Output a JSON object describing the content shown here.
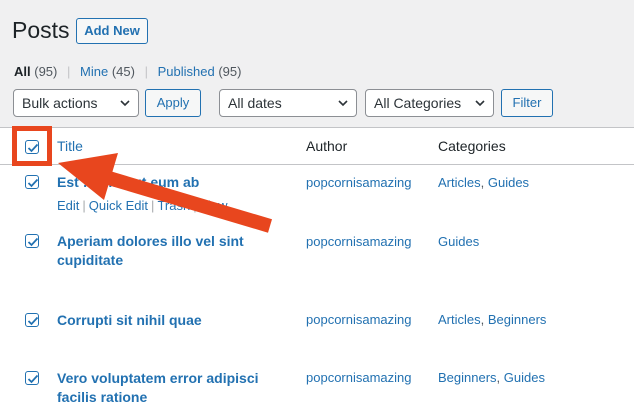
{
  "header": {
    "title": "Posts",
    "add_new": "Add New"
  },
  "views": {
    "all": "All",
    "all_count": "(95)",
    "mine": "Mine",
    "mine_count": "(45)",
    "published": "Published",
    "published_count": "(95)",
    "separator": "|"
  },
  "toolbar": {
    "bulk_actions": "Bulk actions",
    "apply": "Apply",
    "dates": "All dates",
    "categories": "All Categories",
    "filter": "Filter"
  },
  "table": {
    "columns": {
      "title": "Title",
      "author": "Author",
      "categories": "Categories"
    },
    "rows": [
      {
        "title": "Est … emo ut eum ab",
        "author": "popcornisamazing",
        "categories": [
          "Articles",
          "Guides"
        ],
        "actions": [
          "Edit",
          "Quick Edit",
          "Trash",
          "View"
        ]
      },
      {
        "title_line1": "Aperiam dolores illo vel sint",
        "title_line2": "cupiditate",
        "author": "popcornisamazing",
        "categories": [
          "Guides"
        ]
      },
      {
        "title": "Corrupti sit nihil quae",
        "author": "popcornisamazing",
        "categories": [
          "Articles",
          "Beginners"
        ]
      },
      {
        "title_line1": "Vero voluptatem error adipisci",
        "title_line2": "facilis ratione",
        "author": "popcornisamazing",
        "categories": [
          "Beginners",
          "Guides"
        ]
      }
    ]
  },
  "colors": {
    "accent": "#2271b1",
    "annotation": "#e8461e",
    "background": "#f0f0f1"
  },
  "icons": {
    "checkbox": "checkmark-icon",
    "dropdown": "chevron-down-icon",
    "annotation": "arrow-annotation"
  }
}
